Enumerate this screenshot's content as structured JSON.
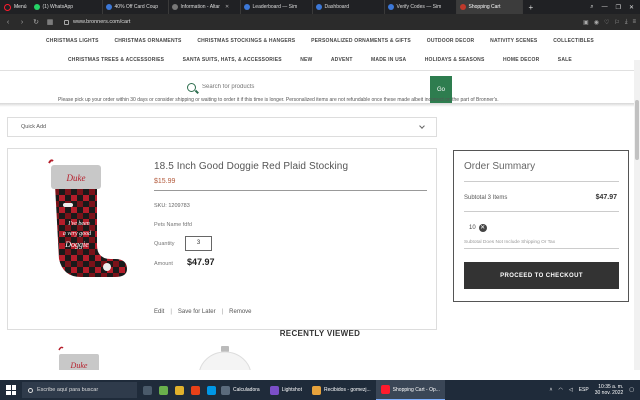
{
  "browser": {
    "menu_label": "Menú",
    "tabs": [
      {
        "label": "(1) WhatsApp",
        "color": "#25d366"
      },
      {
        "label": "40% Off Card Coup",
        "color": "#3c78d8"
      },
      {
        "label": "Information - Altar",
        "color": "#777777"
      },
      {
        "label": "Leaderboard — Sim",
        "color": "#3c78d8"
      },
      {
        "label": "Dashboard",
        "color": "#3c78d8"
      },
      {
        "label": "Verify Codes — Sim",
        "color": "#3c78d8"
      },
      {
        "label": "Shopping Cart",
        "color": "#c0392b",
        "active": true
      }
    ],
    "url": "www.bronners.com/cart"
  },
  "nav": {
    "row1": [
      "CHRISTMAS LIGHTS",
      "CHRISTMAS ORNAMENTS",
      "CHRISTMAS STOCKINGS & HANGERS",
      "PERSONALIZED ORNAMENTS & GIFTS",
      "OUTDOOR DECOR",
      "NATIVITY SCENES",
      "COLLECTIBLES"
    ],
    "row2": [
      "CHRISTMAS TREES & ACCESSORIES",
      "SANTA SUITS, HATS, & ACCESSORIES",
      "NEW",
      "ADVENT",
      "MADE IN USA",
      "HOLIDAYS & SEASONS",
      "HOME DECOR",
      "SALE"
    ]
  },
  "search": {
    "placeholder": "Search for products",
    "go_label": "Go"
  },
  "notice": "Please pick up your order within 30 days or consider shipping or waiting to order it if this time is longer. Personalized items are not refundable once these made albeit incorrect on the part of Bronner's.",
  "quick_add": {
    "label": "Quick Add"
  },
  "cart_item": {
    "title": "18.5 Inch Good Doggie Red Plaid Stocking",
    "price": "$15.99",
    "sku_label": "SKU:",
    "sku": "1209783",
    "pets_label": "Pets Name",
    "pets_value": "fdfd",
    "quantity_label": "Quantity",
    "quantity": "3",
    "amount_label": "Amount",
    "amount": "$47.97",
    "stocking_name": "Duke",
    "stocking_text1": "I've been",
    "stocking_text2": "a very good",
    "stocking_text3": "Doggie",
    "actions": {
      "edit": "Edit",
      "save": "Save for Later",
      "remove": "Remove"
    }
  },
  "summary": {
    "title": "Order Summary",
    "subtotal_label": "Subtotal 3 Items",
    "subtotal_value": "$47.97",
    "coupon": "10",
    "note": "Subtotal Does Not Include Shipping Or Tax",
    "checkout_label": "PROCEED TO CHECKOUT"
  },
  "recently_viewed": {
    "title": "RECENTLY VIEWED",
    "stocking_name": "Duke"
  },
  "taskbar": {
    "search_placeholder": "Escribe aquí para buscar",
    "apps": [
      {
        "label": "Calculadora",
        "color": "#5b6b7d"
      },
      {
        "label": "Lightshot",
        "color": "#7b4fc9"
      },
      {
        "label": "Recibidos - gomezj...",
        "color": "#e8a33c"
      },
      {
        "label": "Shopping Cart - Op...",
        "color": "#ff1b2d",
        "active": true
      }
    ],
    "language": "ESP",
    "time": "10:35 a. m.",
    "date": "30 nov. 2022"
  },
  "colors": {
    "accent_green": "#2e7d4f",
    "price_color": "#b35a3c",
    "checkout_bg": "#333333"
  }
}
